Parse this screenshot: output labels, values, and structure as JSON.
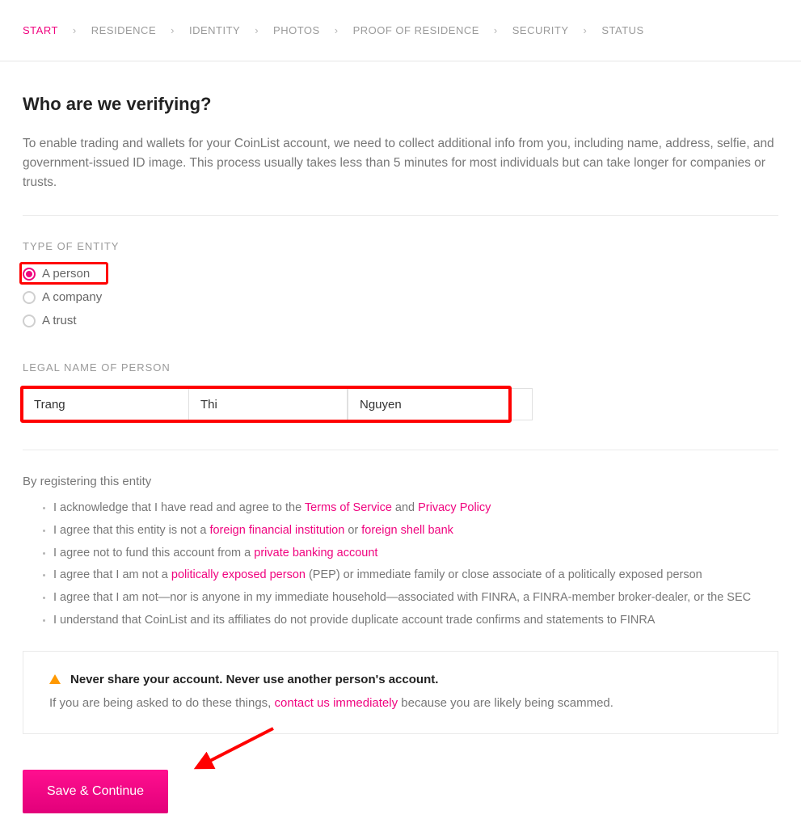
{
  "breadcrumb": {
    "items": [
      "START",
      "RESIDENCE",
      "IDENTITY",
      "PHOTOS",
      "PROOF OF RESIDENCE",
      "SECURITY",
      "STATUS"
    ],
    "activeIndex": 0
  },
  "heading": "Who are we verifying?",
  "intro": "To enable trading and wallets for your CoinList account, we need to collect additional info from you, including name, address, selfie, and government-issued ID image. This process usually takes less than 5 minutes for most individuals but can take longer for companies or trusts.",
  "entity": {
    "label": "TYPE OF ENTITY",
    "options": [
      {
        "label": "A person",
        "checked": true
      },
      {
        "label": "A company",
        "checked": false
      },
      {
        "label": "A trust",
        "checked": false
      }
    ]
  },
  "legalName": {
    "label": "LEGAL NAME OF PERSON",
    "first": "Trang",
    "middle": "Thi",
    "last": "Nguyen"
  },
  "agreements": {
    "intro": "By registering this entity",
    "items": [
      {
        "prefix": "I acknowledge that I have read and agree to the ",
        "link1": "Terms of Service",
        "mid": " and ",
        "link2": "Privacy Policy",
        "suffix": ""
      },
      {
        "prefix": "I agree that this entity is not a ",
        "link1": "foreign financial institution",
        "mid": " or ",
        "link2": "foreign shell bank",
        "suffix": ""
      },
      {
        "prefix": "I agree not to fund this account from a ",
        "link1": "private banking account",
        "mid": "",
        "link2": "",
        "suffix": ""
      },
      {
        "prefix": "I agree that I am not a ",
        "link1": "politically exposed person",
        "mid": "",
        "link2": "",
        "suffix": " (PEP) or immediate family or close associate of a politically exposed person"
      },
      {
        "prefix": "I agree that I am not—nor is anyone in my immediate household—associated with FINRA, a FINRA-member broker-dealer, or the SEC",
        "link1": "",
        "mid": "",
        "link2": "",
        "suffix": ""
      },
      {
        "prefix": "I understand that CoinList and its affiliates do not provide duplicate account trade confirms and statements to FINRA",
        "link1": "",
        "mid": "",
        "link2": "",
        "suffix": ""
      }
    ]
  },
  "warning": {
    "title": "Never share your account. Never use another person's account.",
    "textPrefix": "If you are being asked to do these things, ",
    "textLink": "contact us immediately",
    "textSuffix": " because you are likely being scammed."
  },
  "saveButton": "Save & Continue"
}
